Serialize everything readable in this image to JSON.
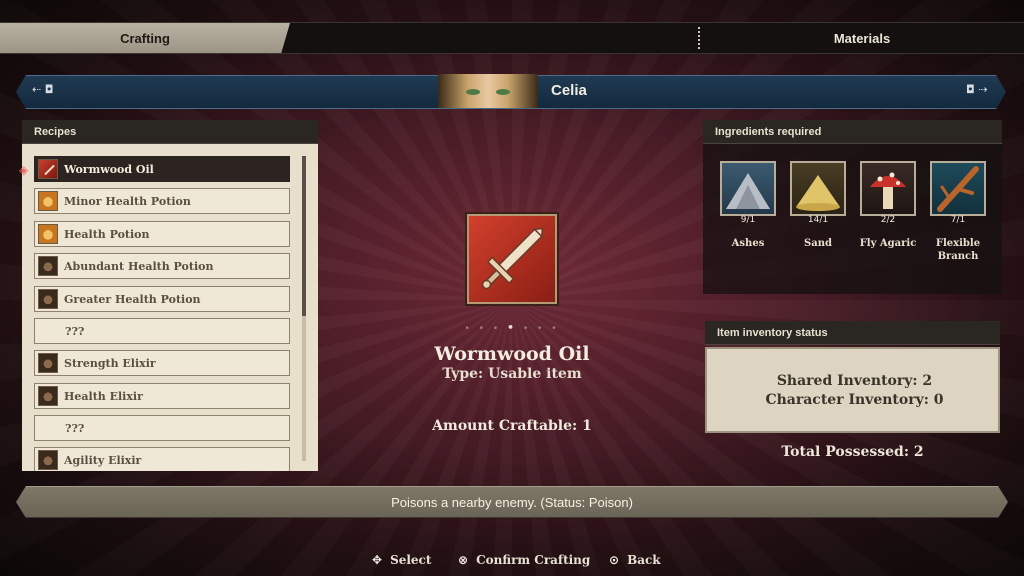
{
  "tabs": {
    "crafting": "Crafting",
    "materials": "Materials"
  },
  "character": {
    "name": "Celia",
    "prev_hint": "⇠ ◘",
    "next_hint": "◘ ⇢"
  },
  "recipes": {
    "header": "Recipes",
    "items": [
      {
        "label": "Wormwood Oil",
        "icon": "red"
      },
      {
        "label": "Minor Health Potion",
        "icon": "orange"
      },
      {
        "label": "Health Potion",
        "icon": "orange"
      },
      {
        "label": "Abundant Health Potion",
        "icon": "dark"
      },
      {
        "label": "Greater Health Potion",
        "icon": "dark"
      },
      {
        "label": "???",
        "icon": "empty"
      },
      {
        "label": "Strength Elixir",
        "icon": "dark"
      },
      {
        "label": "Health Elixir",
        "icon": "dark"
      },
      {
        "label": "???",
        "icon": "empty"
      },
      {
        "label": "Agility Elixir",
        "icon": "dark"
      }
    ]
  },
  "item": {
    "name": "Wormwood Oil",
    "type": "Type: Usable item",
    "craftable": "Amount Craftable: 1",
    "icon": "sword-icon"
  },
  "ingredients": {
    "header": "Ingredients required",
    "items": [
      {
        "count": "9/1",
        "name": "Ashes",
        "icon": "ashes-icon"
      },
      {
        "count": "14/1",
        "name": "Sand",
        "icon": "sand-icon"
      },
      {
        "count": "2/2",
        "name": "Fly Agaric",
        "icon": "mushroom-icon"
      },
      {
        "count": "7/1",
        "name": "Flexible Branch",
        "icon": "branch-icon"
      }
    ]
  },
  "inventory": {
    "header": "Item inventory status",
    "shared": "Shared Inventory: 2",
    "character": "Character Inventory: 0",
    "total": "Total Possessed: 2"
  },
  "description": "Poisons a nearby enemy. (Status: Poison)",
  "prompts": {
    "select": "Select",
    "confirm": "Confirm Crafting",
    "back": "Back"
  },
  "colors": {
    "background": "#4a1c26",
    "panel_light": "#e8e0cc",
    "panel_dark": "#2a2622",
    "selected_row": "#2b2420",
    "accent_blue": "#1f3a52",
    "item_red": "#d2402c"
  }
}
